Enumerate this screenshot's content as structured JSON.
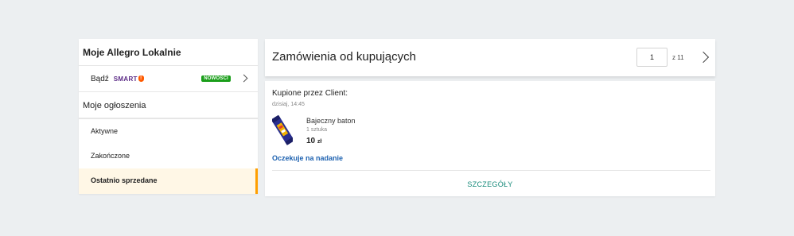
{
  "sidebar": {
    "title": "Moje Allegro Lokalnie",
    "smart_prefix": "Bądź",
    "smart_logo": "SMART",
    "smart_badge": "NOWOŚCI",
    "section_title": "Moje ogłoszenia",
    "items": [
      {
        "label": "Aktywne",
        "active": false
      },
      {
        "label": "Zakończone",
        "active": false
      },
      {
        "label": "Ostatnio sprzedane",
        "active": true
      }
    ]
  },
  "header": {
    "title": "Zamówienia od kupujących",
    "page_current": "1",
    "page_of": "z 11"
  },
  "order": {
    "buyer_line": "Kupione przez Client:",
    "date": "dzisiaj, 14:45",
    "product_name": "Bajeczny baton",
    "quantity": "1 sztuka",
    "price_value": "10",
    "price_currency": "zł",
    "status": "Oczekuje na nadanie",
    "details_label": "SZCZEGÓŁY"
  },
  "colors": {
    "accent_orange": "#ff9f00",
    "link_blue": "#1e62b0",
    "details_teal": "#168a7a",
    "badge_green": "#1a9e1a",
    "smart_purple": "#5b2a86"
  },
  "icons": {
    "smart_exclaim": "!",
    "chevron": "chevron-right-icon"
  }
}
